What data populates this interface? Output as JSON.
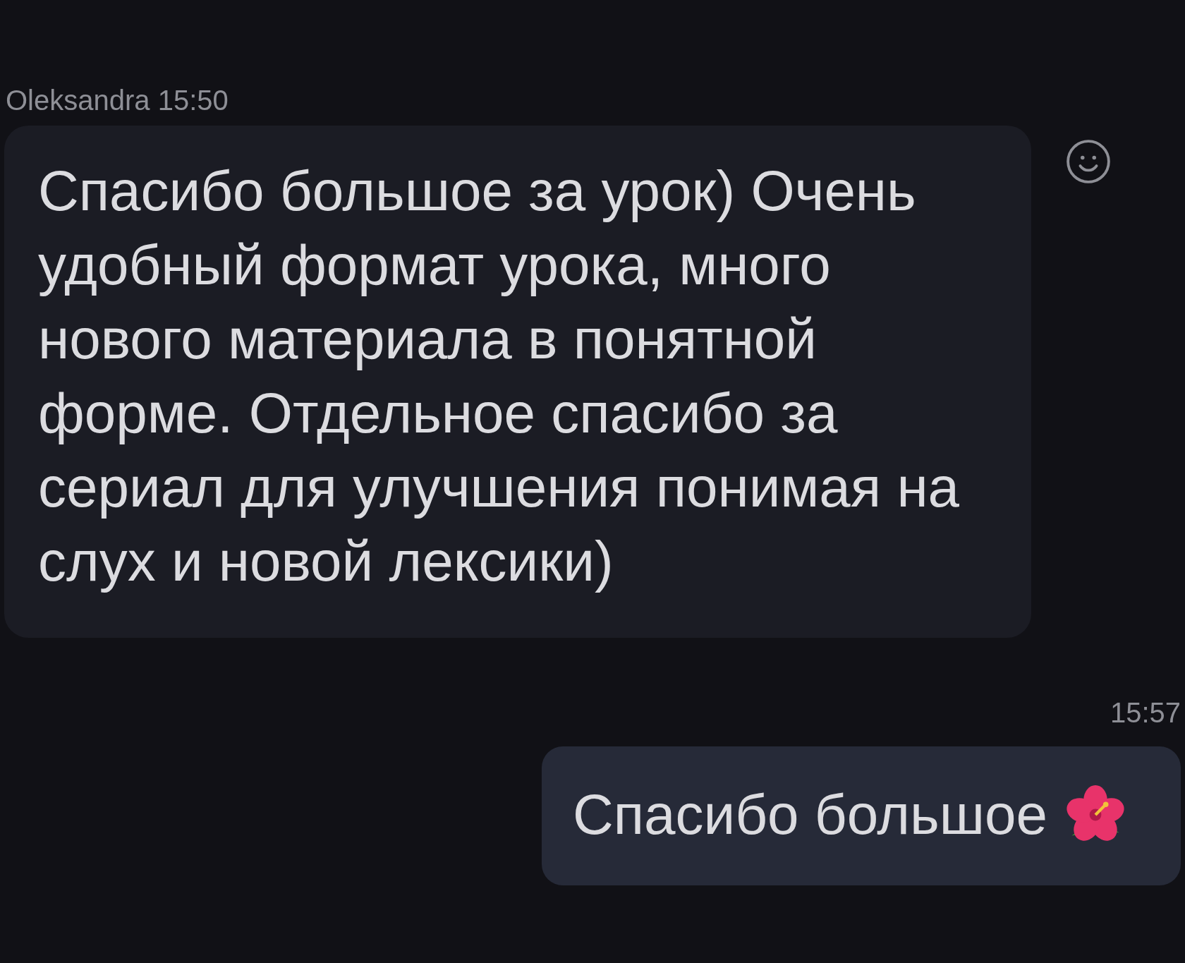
{
  "messages": [
    {
      "kind": "incoming",
      "sender": "Oleksandra",
      "time": "15:50",
      "text": "Спасибо большое за урок) Очень\nудобный формат урока, много\nнового материала в понятной\nформе. Отдельное спасибо за\nсериал для улучшения понимая на\nслух и новой лексики)",
      "reaction_button": true,
      "emoji": false
    },
    {
      "kind": "outgoing",
      "time": "15:57",
      "text": "Спасибо большое",
      "reaction_button": false,
      "emoji": true
    }
  ]
}
